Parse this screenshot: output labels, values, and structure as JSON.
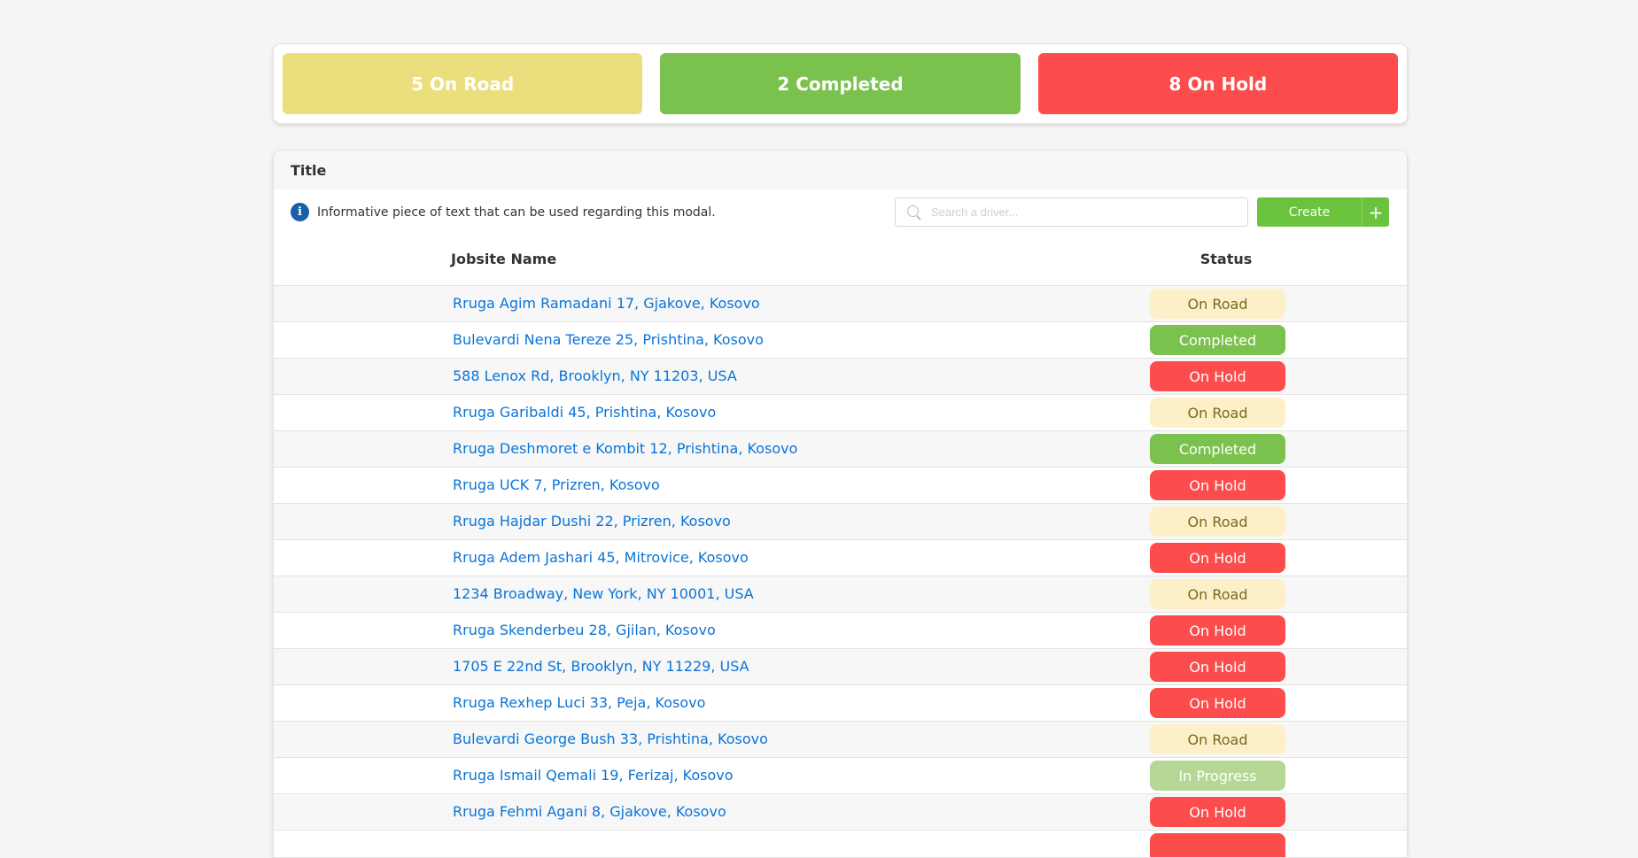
{
  "stats": {
    "on_road": "5 On Road",
    "completed": "2 Completed",
    "on_hold": "8 On Hold"
  },
  "panel": {
    "title": "Title",
    "info_text": "Informative piece of text that can be used regarding this modal.",
    "search_placeholder": "Search a driver...",
    "create_label": "Create",
    "plus_label": "+"
  },
  "table": {
    "headers": {
      "name": "Jobsite Name",
      "status": "Status"
    },
    "rows": [
      {
        "name": "Rruga Agim Ramadani 17, Gjakove, Kosovo",
        "status": "On Road",
        "kind": "road"
      },
      {
        "name": "Bulevardi Nena Tereze 25, Prishtina, Kosovo",
        "status": "Completed",
        "kind": "completed"
      },
      {
        "name": "588 Lenox Rd, Brooklyn, NY 11203, USA",
        "status": "On Hold",
        "kind": "hold"
      },
      {
        "name": "Rruga Garibaldi 45, Prishtina, Kosovo",
        "status": "On Road",
        "kind": "road"
      },
      {
        "name": "Rruga Deshmoret e Kombit 12, Prishtina, Kosovo",
        "status": "Completed",
        "kind": "completed"
      },
      {
        "name": "Rruga UCK 7, Prizren, Kosovo",
        "status": "On Hold",
        "kind": "hold"
      },
      {
        "name": "Rruga Hajdar Dushi 22, Prizren, Kosovo",
        "status": "On Road",
        "kind": "road"
      },
      {
        "name": "Rruga Adem Jashari 45, Mitrovice, Kosovo",
        "status": "On Hold",
        "kind": "hold"
      },
      {
        "name": "1234 Broadway, New York, NY 10001, USA",
        "status": "On Road",
        "kind": "road"
      },
      {
        "name": "Rruga Skenderbeu 28, Gjilan, Kosovo",
        "status": "On Hold",
        "kind": "hold"
      },
      {
        "name": "1705 E 22nd St, Brooklyn, NY 11229, USA",
        "status": "On Hold",
        "kind": "hold"
      },
      {
        "name": "Rruga Rexhep Luci 33, Peja, Kosovo",
        "status": "On Hold",
        "kind": "hold"
      },
      {
        "name": "Bulevardi George Bush 33, Prishtina, Kosovo",
        "status": "On Road",
        "kind": "road"
      },
      {
        "name": "Rruga Ismail Qemali 19, Ferizaj, Kosovo",
        "status": "In Progress",
        "kind": "progress"
      },
      {
        "name": "Rruga Fehmi Agani 8, Gjakove, Kosovo",
        "status": "On Hold",
        "kind": "hold"
      },
      {
        "name": "",
        "status": "",
        "kind": "hold"
      }
    ]
  }
}
